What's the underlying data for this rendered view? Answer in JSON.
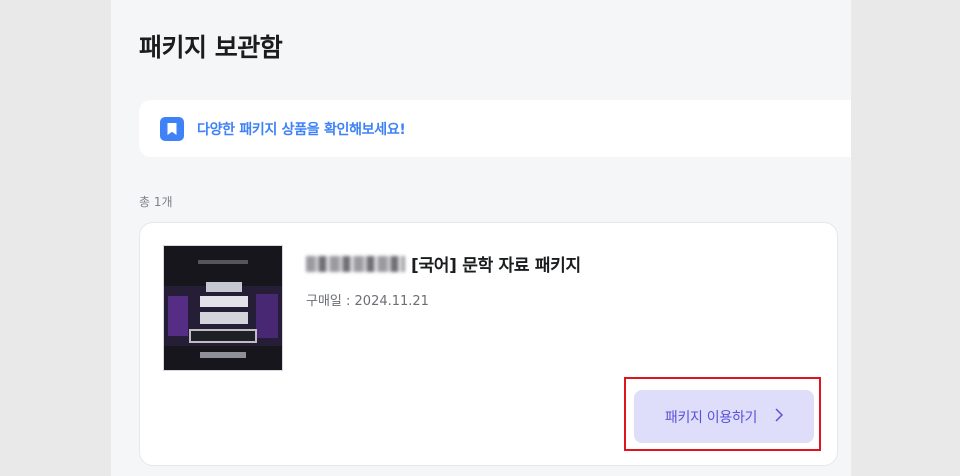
{
  "page": {
    "title": "패키지 보관함"
  },
  "banner": {
    "text": "다양한 패키지 상품을 확인해보세요!",
    "icon": "bookmark-icon",
    "accent": "#3f82f7"
  },
  "list": {
    "total_label": "총 1개",
    "items": [
      {
        "product_name": "[국어] 문학 자료 패키지",
        "purchase_date": "구매일 : 2024.11.21",
        "use_button_label": "패키지 이용하기",
        "use_button_icon": "chevron-right-icon"
      }
    ]
  },
  "colors": {
    "button_bg": "#dfdefa",
    "button_text": "#5a51d9",
    "highlight": "#e0141c"
  }
}
